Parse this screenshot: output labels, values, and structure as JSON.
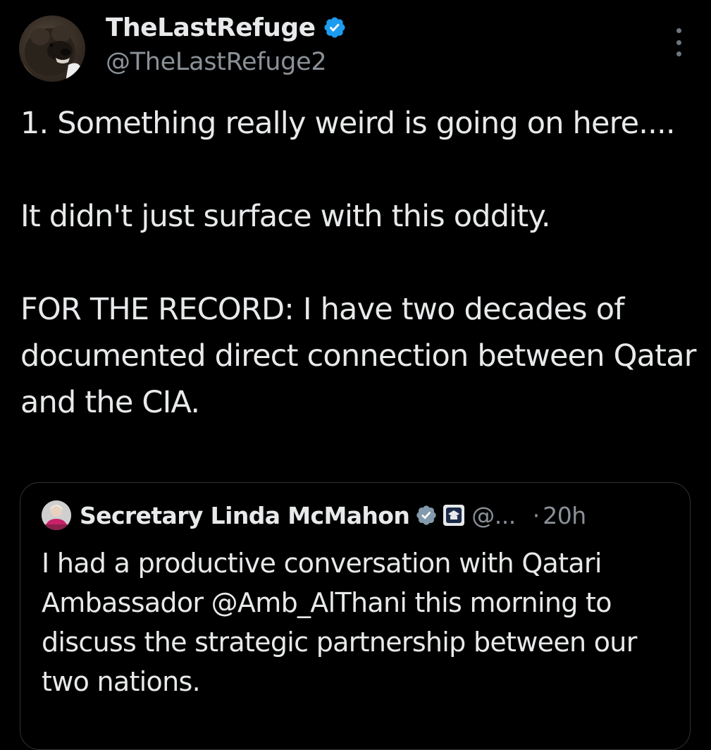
{
  "author": {
    "display_name": "TheLastRefuge",
    "handle": "@TheLastRefuge2",
    "avatar": "bear-avatar",
    "verified_icon": "verified-badge-icon"
  },
  "menu": {
    "icon": "more-options-icon"
  },
  "tweet": {
    "paragraphs": [
      "1.  Something really weird is going on here....",
      "It didn't just surface with this oddity.",
      "FOR THE RECORD: I have two decades of documented direct connection between Qatar and the CIA."
    ]
  },
  "quote": {
    "display_name": "Secretary Linda McMahon",
    "handle": "@...",
    "separator": "·",
    "time": "20h",
    "avatar": "profile-photo-avatar",
    "gov_badge_icon": "government-verified-badge-icon",
    "affiliation_icon": "department-of-education-affiliation-icon",
    "text": "I had a productive conversation with Qatari Ambassador @Amb_AlThani this morning to discuss the strategic partnership between our two nations."
  },
  "colors": {
    "background": "#000000",
    "text_primary": "#e7e9ea",
    "text_secondary": "#8b9198",
    "verified_blue": "#1d9bf0",
    "border": "#2f3336"
  }
}
